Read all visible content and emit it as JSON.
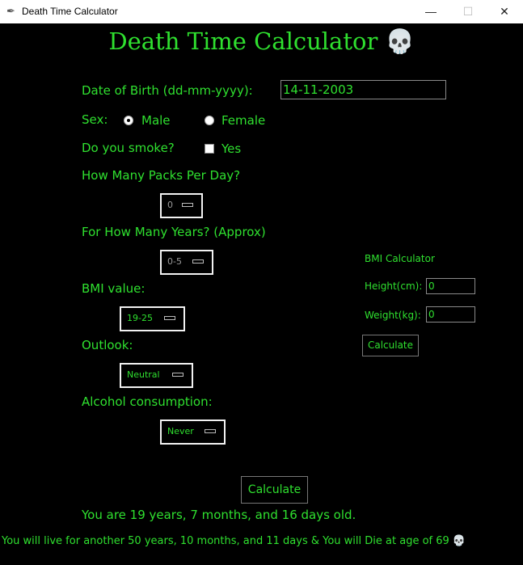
{
  "window": {
    "title": "Death Time Calculator",
    "minimize": "—",
    "maximize": "☐",
    "close": "✕"
  },
  "header": {
    "title": "Death Time Calculator 💀"
  },
  "dob": {
    "label": "Date of Birth (dd-mm-yyyy):",
    "value": "14-11-2003"
  },
  "sex": {
    "label": "Sex:",
    "options": [
      "Male",
      "Female"
    ],
    "selected": "Male"
  },
  "smoke": {
    "label": "Do you smoke?",
    "option": "Yes",
    "checked": false
  },
  "packs": {
    "label": "How Many Packs Per Day?",
    "value": "0"
  },
  "years": {
    "label": "For How Many Years? (Approx)",
    "value": "0-5"
  },
  "bmi": {
    "label": "BMI value:",
    "value": "19-25"
  },
  "outlook": {
    "label": "Outlook:",
    "value": "Neutral"
  },
  "alcohol": {
    "label": "Alcohol consumption:",
    "value": "Never"
  },
  "bmi_calc": {
    "title": "BMI Calculator",
    "height_label": "Height(cm):",
    "height_value": "0",
    "weight_label": "Weight(kg):",
    "weight_value": "0",
    "button": "Calculate"
  },
  "main_button": "Calculate",
  "result": {
    "age": "You are 19 years, 7 months, and 16 days old.",
    "prediction": "You will live for another 50 years, 10 months, and 11 days & You will Die at age of 69 💀"
  },
  "colors": {
    "accent": "#2fe02f",
    "background": "#000000"
  }
}
